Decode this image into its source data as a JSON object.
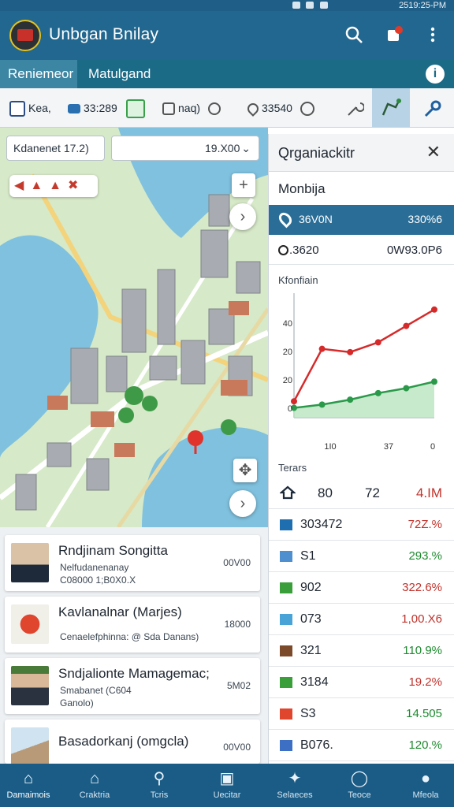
{
  "status_bar": {
    "time": "2519:25-PM"
  },
  "app": {
    "title": "Unbgan Bnilay"
  },
  "tabs": [
    {
      "label": "Reniemeor"
    },
    {
      "label": "Matulgand"
    }
  ],
  "toolbar": {
    "item1": "Kea,",
    "item2": "33:289",
    "item3": "naq)",
    "item4": "33540"
  },
  "map": {
    "search_value": "Kdanenet 17.2)",
    "dropdown_value": "19.X00"
  },
  "cards": [
    {
      "title": "Rndjinam Songitta",
      "line1": "Nelfudanenanay",
      "line2": "C08000 1;B0X0.X",
      "value": "00V00"
    },
    {
      "title": "Kavlanalnar (Marjes)",
      "line1": "Cenaelefphinna: @ Sda Danans)",
      "line2": "",
      "value": "18000"
    },
    {
      "title": "Sndjalionte Mamagemac;",
      "line1": "Smabanet (C604",
      "line2": "Ganolo)",
      "value": "5M02"
    },
    {
      "title": "Basadorkanj (omgcla)",
      "line1": "",
      "line2": "",
      "value": "00V00"
    }
  ],
  "panel": {
    "title": "Qrganiackitr",
    "subtitle": "Monbija",
    "highlight": {
      "left": "36V0N",
      "right": "330%6"
    },
    "row2": {
      "left": ".3620",
      "right": "0W93.0P6"
    },
    "chart_label": "Kfonfiain",
    "table_label": "Terars",
    "header": {
      "c1": "80",
      "c2": "72",
      "c3": "4.IM"
    },
    "rows": [
      {
        "name": "303472",
        "pct": "72Z.%",
        "color": "#1f6fb0",
        "pct_color": "#c0322b"
      },
      {
        "name": "S1",
        "pct": "293.%",
        "color": "#4f8fd0",
        "pct_color": "#1d8a2e"
      },
      {
        "name": "902",
        "pct": "322.6%",
        "color": "#3a9e3a",
        "pct_color": "#c0322b"
      },
      {
        "name": "073",
        "pct": "1,00.X6",
        "color": "#4aa3d6",
        "pct_color": "#c0322b"
      },
      {
        "name": "321",
        "pct": "110.9%",
        "color": "#7a4a2a",
        "pct_color": "#1d8a2e"
      },
      {
        "name": "3184",
        "pct": "19.2%",
        "color": "#3a9e3a",
        "pct_color": "#c0322b"
      },
      {
        "name": "S3",
        "pct": "14.505",
        "color": "#e0452e",
        "pct_color": "#1d8a2e"
      },
      {
        "name": "B076.",
        "pct": "120.%",
        "color": "#3d6fc4",
        "pct_color": "#1d8a2e"
      }
    ]
  },
  "chart_data": {
    "type": "line",
    "title": "Kfonfiain",
    "xlabel": "",
    "ylabel": "",
    "x_tick_labels": [
      "1I0",
      "37",
      "0"
    ],
    "y_tick_labels": [
      "40",
      "20",
      "20",
      "0"
    ],
    "series": [
      {
        "color": "#d62a2a",
        "x": [
          0,
          1,
          2,
          3,
          4,
          5
        ],
        "values": [
          4,
          36,
          34,
          40,
          50,
          60
        ]
      },
      {
        "color": "#2a9a4a",
        "x": [
          0,
          1,
          2,
          3,
          4,
          5
        ],
        "values": [
          0,
          2,
          5,
          9,
          12,
          16
        ]
      }
    ],
    "ylim": [
      -6,
      70
    ]
  },
  "bottom_nav": [
    {
      "label": "Damaimois"
    },
    {
      "label": "Craktria"
    },
    {
      "label": "Tcris"
    },
    {
      "label": "Uecitar"
    },
    {
      "label": "Selaeces"
    },
    {
      "label": "Teoce"
    },
    {
      "label": "Mfeola"
    }
  ]
}
